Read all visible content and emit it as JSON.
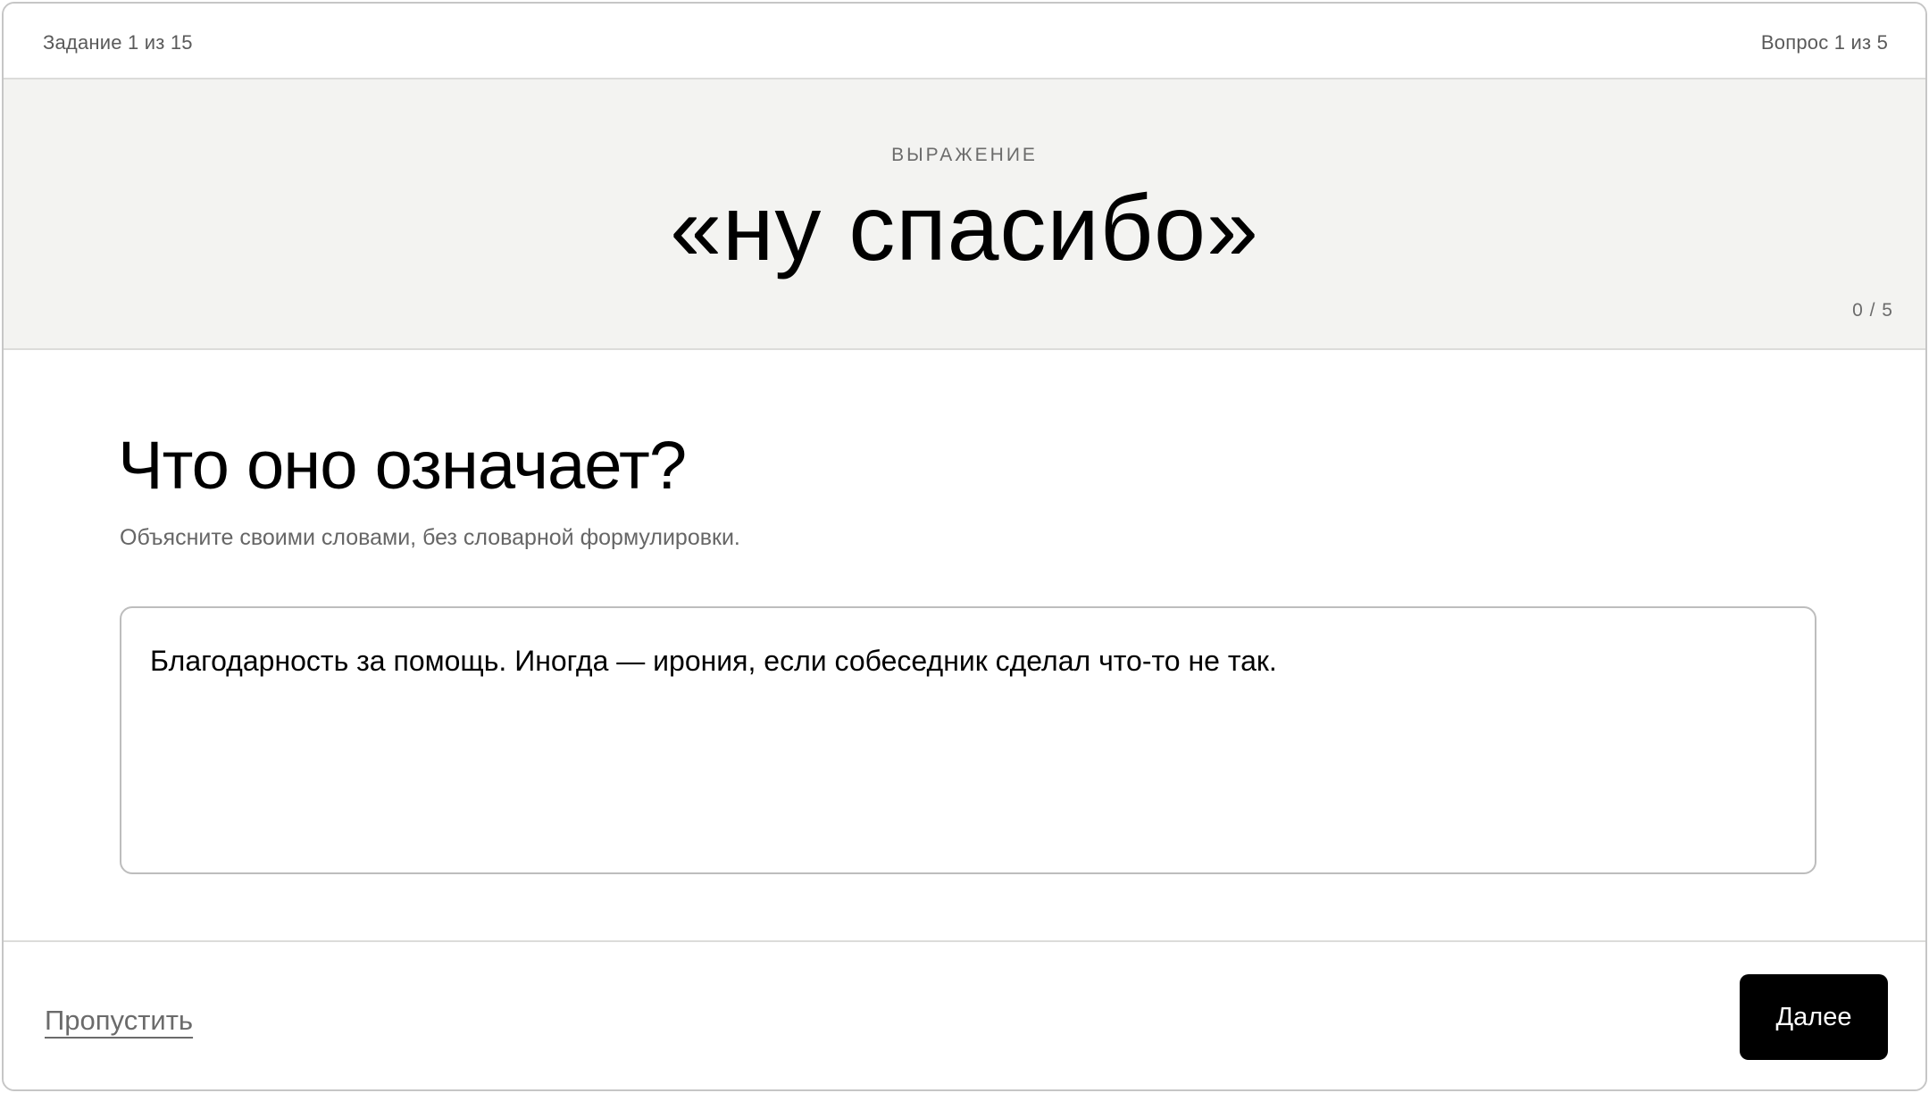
{
  "header": {
    "task_counter": "Задание 1 из 15",
    "question_counter": "Вопрос 1 из 5"
  },
  "expression": {
    "kind_label": "ВЫРАЖЕНИЕ",
    "phrase": "«ну спасибо»",
    "attempts": "0 / 5"
  },
  "question": {
    "title": "Что оно означает?",
    "hint": "Объясните своими словами, без словарной формулировки.",
    "answer_value": "Благодарность за помощь. Иногда — ирония, если собеседник сделал что-то не так."
  },
  "footer": {
    "skip_label": "Пропустить",
    "next_label": "Далее"
  }
}
